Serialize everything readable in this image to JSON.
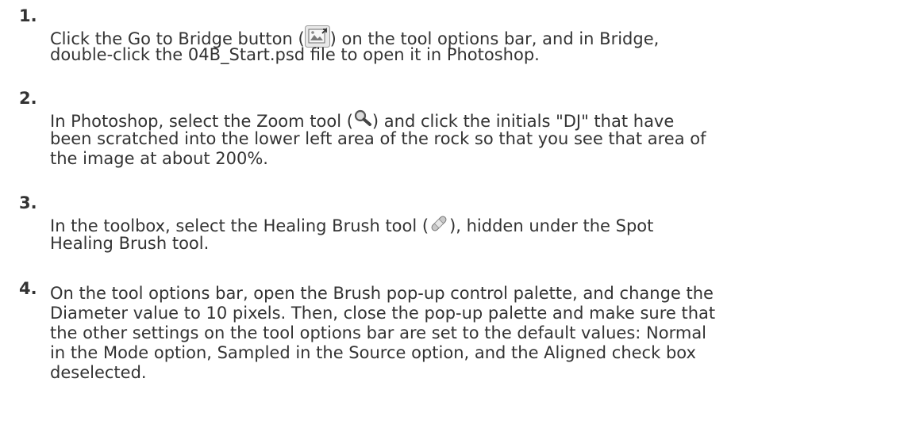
{
  "steps": [
    {
      "number": "1.",
      "lines": [
        [
          "Click the Go to Bridge button (",
          "bridge-icon",
          ") on the tool options bar, and in Bridge,"
        ],
        [
          "double-click the 04B_Start.psd file to open it in Photoshop."
        ]
      ]
    },
    {
      "number": "2.",
      "lines": [
        [
          "In Photoshop, select the Zoom tool (",
          "zoom-icon",
          ") and click the initials \"DJ\" that have"
        ],
        [
          "been scratched into the lower left area of the rock so that you see that area of"
        ],
        [
          "the image at about 200%."
        ]
      ]
    },
    {
      "number": "3.",
      "lines": [
        [
          "In the toolbox, select the Healing Brush tool (",
          "healing-brush-icon",
          "), hidden under the Spot"
        ],
        [
          "Healing Brush tool."
        ]
      ]
    },
    {
      "number": "4.",
      "lines": [
        [
          "On the tool options bar, open the Brush pop-up control palette, and change the"
        ],
        [
          "Diameter value to 10 pixels. Then, close the pop-up palette and make sure that"
        ],
        [
          "the other settings on the tool options bar are set to the default values: Normal"
        ],
        [
          "in the Mode option, Sampled in the Source option, and the Aligned check box"
        ],
        [
          "deselected."
        ]
      ]
    }
  ],
  "icons": {
    "bridge-icon": "bridge-icon",
    "zoom-icon": "magnifier-icon",
    "healing-brush-icon": "bandage-icon"
  },
  "colors": {
    "text": "#333333",
    "background": "#ffffff"
  }
}
